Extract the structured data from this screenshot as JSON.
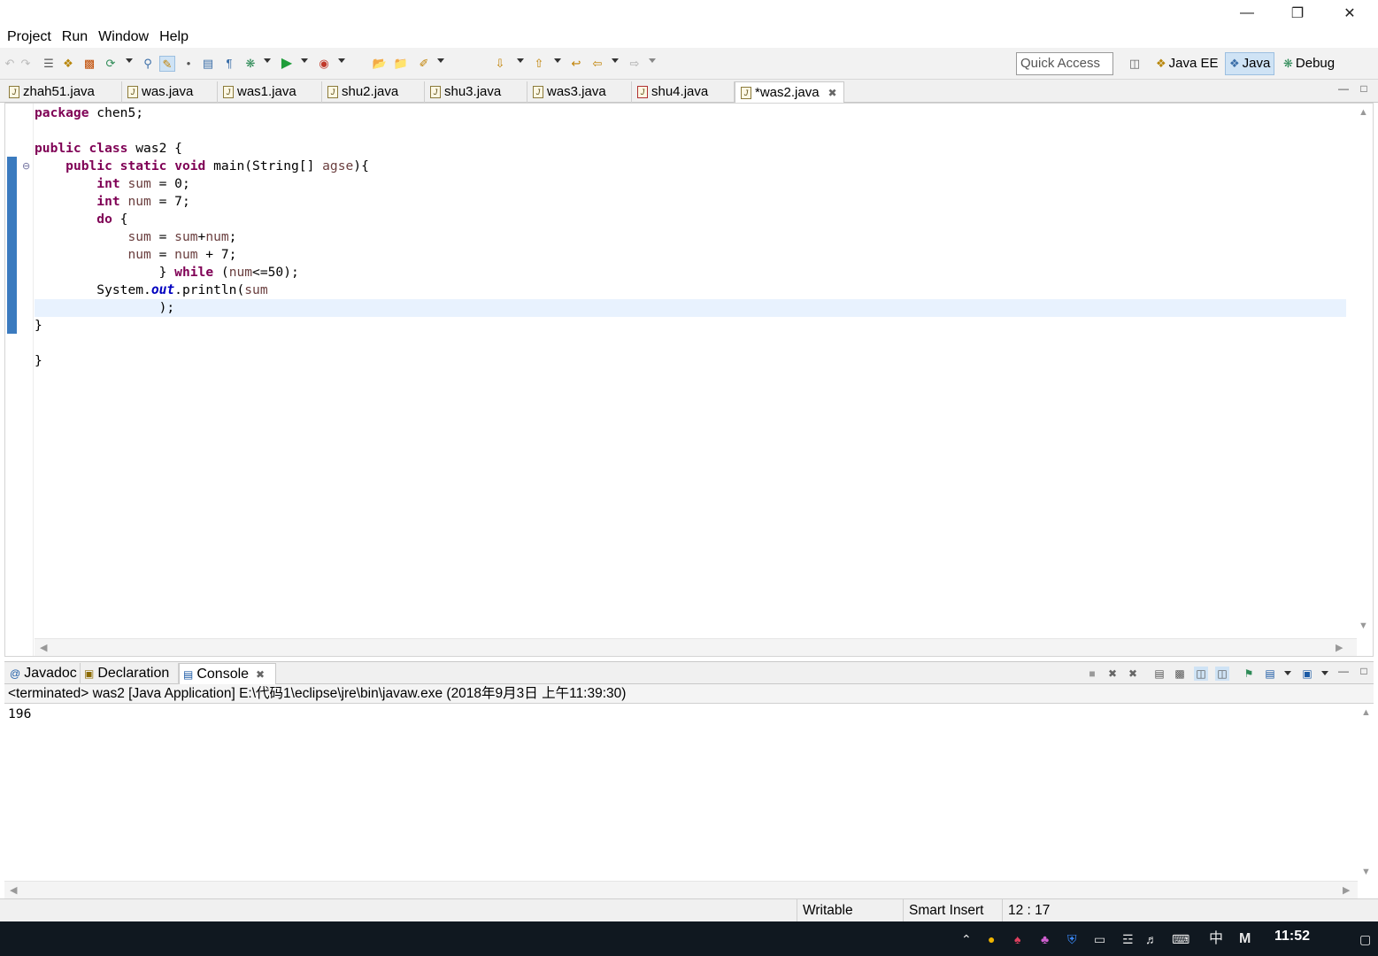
{
  "menu": [
    "Project",
    "Run",
    "Window",
    "Help"
  ],
  "toolbar": {
    "quick_access_placeholder": "Quick Access",
    "perspectives": [
      {
        "label": "Java EE",
        "icon": "java-ee-perspective-icon",
        "active": false
      },
      {
        "label": "Java",
        "icon": "java-perspective-icon",
        "active": true
      },
      {
        "label": "Debug",
        "icon": "debug-perspective-icon",
        "active": false
      }
    ]
  },
  "editor_tabs": [
    {
      "label": "zhah51.java",
      "active": false
    },
    {
      "label": "was.java",
      "active": false
    },
    {
      "label": "was1.java",
      "active": false
    },
    {
      "label": "shu2.java",
      "active": false
    },
    {
      "label": "shu3.java",
      "active": false
    },
    {
      "label": "was3.java",
      "active": false
    },
    {
      "label": "shu4.java",
      "active": false
    },
    {
      "label": "*was2.java",
      "active": true
    }
  ],
  "code": {
    "line1": {
      "kw": "package",
      "rest": " chen5;"
    },
    "line3": {
      "kw1": "public",
      "kw2": "class",
      "rest": " was2 {"
    },
    "line4": {
      "kw1": "public",
      "kw2": "static",
      "kw3": "void",
      "mid": " main(String[] ",
      "param": "agse",
      "end": "){"
    },
    "line5": {
      "kw": "int",
      "var": "sum",
      "rest": " = 0;"
    },
    "line6": {
      "kw": "int",
      "var": "num",
      "rest": " = 7;"
    },
    "line7": {
      "kw": "do",
      "rest": " {"
    },
    "line8": {
      "var1": "sum",
      "mid": " = ",
      "var2": "sum",
      "op": "+",
      "var3": "num",
      "end": ";"
    },
    "line9": {
      "var1": "num",
      "mid": " = ",
      "var2": "num",
      "end": " + 7;"
    },
    "line10": {
      "pre": "} ",
      "kw": "while",
      "mid": " (",
      "var": "num",
      "end": "<=50);"
    },
    "line11": {
      "pre": "System.",
      "field": "out",
      "mid": ".println(",
      "var": "sum"
    },
    "line12": {
      "text": ");"
    },
    "line13": {
      "text": "}"
    },
    "line15": {
      "text": "}"
    }
  },
  "panel": {
    "tabs": [
      {
        "label": "Javadoc",
        "icon": "javadoc-icon"
      },
      {
        "label": "Declaration",
        "icon": "declaration-icon"
      },
      {
        "label": "Console",
        "icon": "console-icon",
        "active": true
      }
    ],
    "console_description": "<terminated> was2 [Java Application] E:\\代码1\\eclipse\\jre\\bin\\javaw.exe (2018年9月3日 上午11:39:30)",
    "console_output": "196"
  },
  "status": {
    "writable": "Writable",
    "insert_mode": "Smart Insert",
    "position": "12 : 17"
  },
  "taskbar": {
    "ime": "中",
    "ime2": "M",
    "clock": "11:52"
  }
}
